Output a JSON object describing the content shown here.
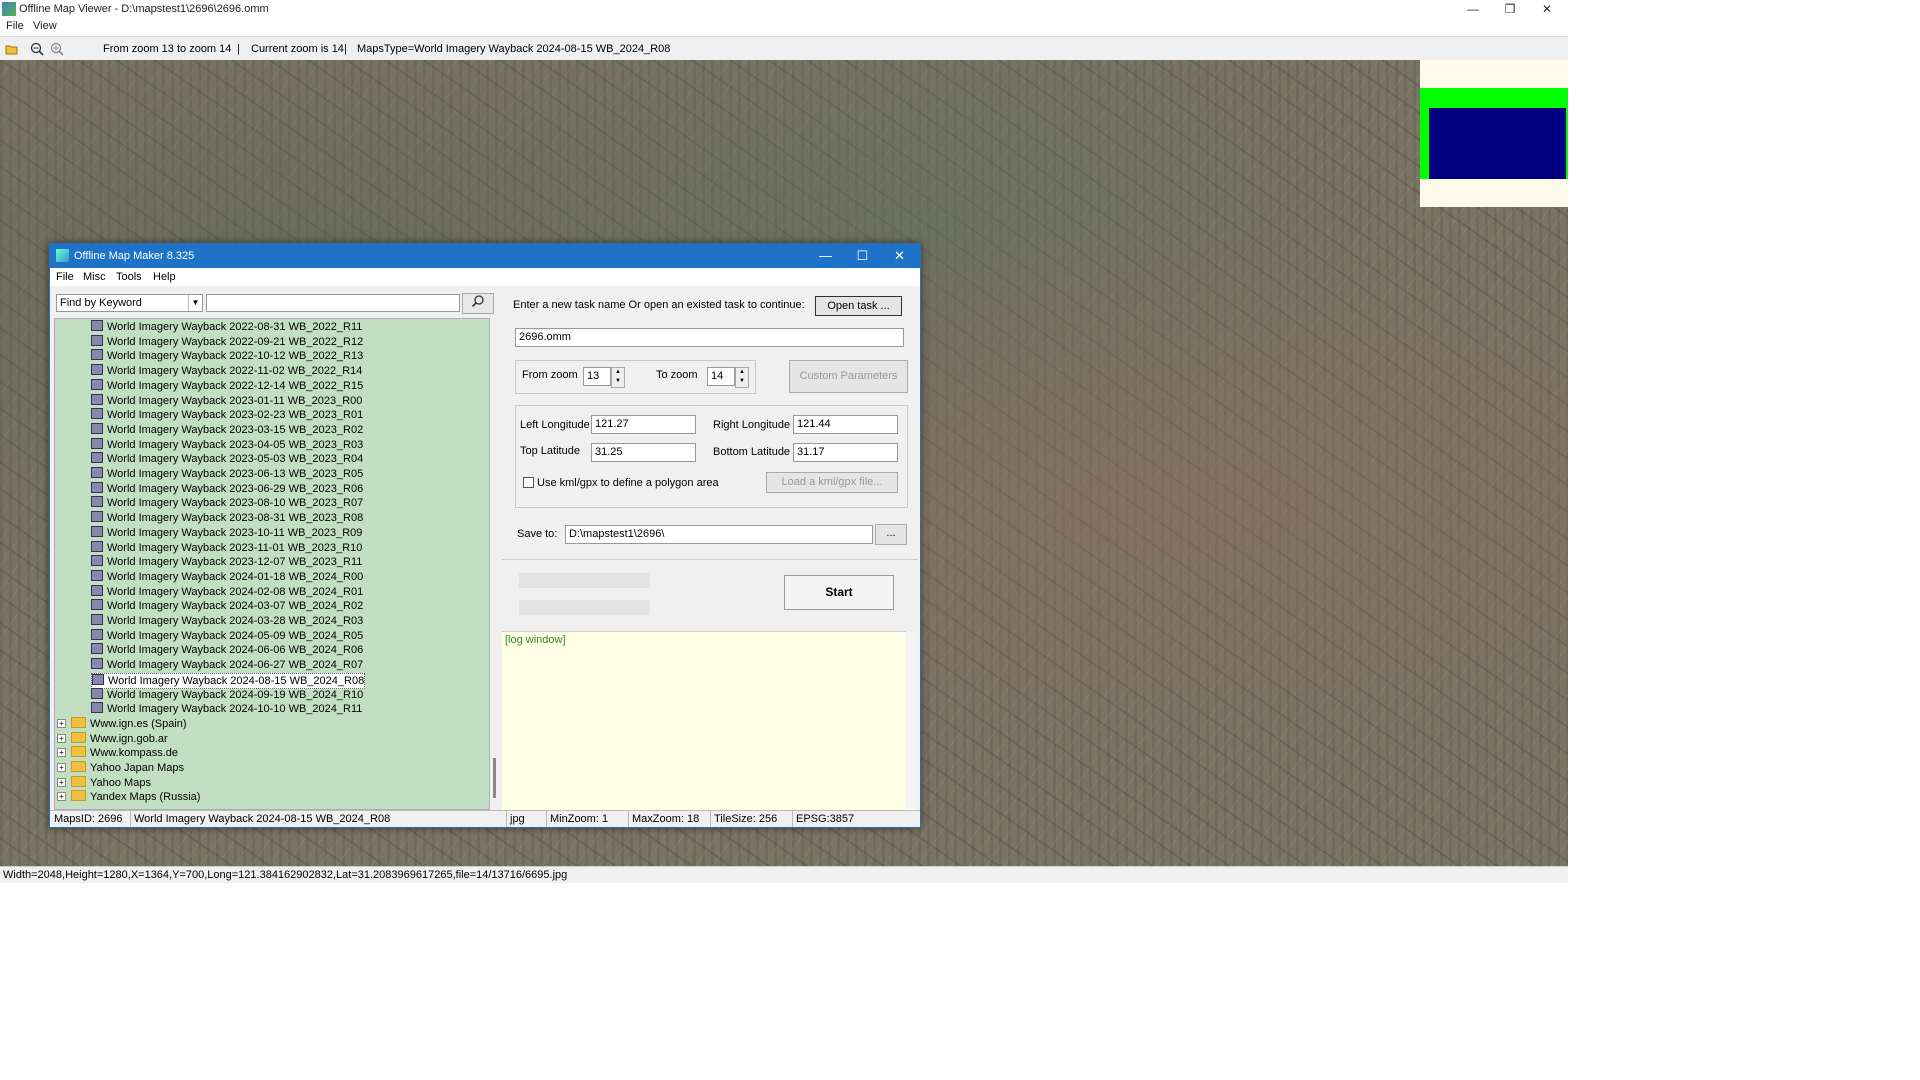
{
  "window": {
    "title": "Offline Map Viewer - D:\\mapstest1\\2696\\2696.omm",
    "menu": [
      "File",
      "View"
    ],
    "controls": {
      "minimize": "—",
      "maximize": "❐",
      "close": "✕"
    }
  },
  "toolbar": {
    "zoom_range": "From zoom 13 to zoom 14",
    "sep1": "|",
    "current_zoom": "Current zoom is 14",
    "sep2": "|",
    "maps_type": "MapsType=World Imagery Wayback 2024-08-15 WB_2024_R08",
    "icons": [
      "folder-open-icon",
      "zoom-out-icon",
      "zoom-in-icon"
    ]
  },
  "statusbar": {
    "text": "Width=2048,Height=1280,X=1364,Y=700,Long=121.384162902832,Lat=31.2083969617265,file=14/13716/6695.jpg"
  },
  "minimap": {
    "colors": {
      "background": "#fffbea",
      "frame": "#00ff00",
      "view": "#000080"
    }
  },
  "dialog": {
    "title": "Offline Map Maker 8.325",
    "menu": [
      "File",
      "Misc",
      "Tools",
      "Help"
    ],
    "controls": {
      "minimize": "—",
      "maximize": "☐",
      "close": "✕"
    },
    "search": {
      "mode": "Find by Keyword",
      "query": "",
      "button_icon": "search-icon"
    },
    "tree": {
      "leaves": [
        "World Imagery Wayback 2022-08-31 WB_2022_R11",
        "World Imagery Wayback 2022-09-21 WB_2022_R12",
        "World Imagery Wayback 2022-10-12 WB_2022_R13",
        "World Imagery Wayback 2022-11-02 WB_2022_R14",
        "World Imagery Wayback 2022-12-14 WB_2022_R15",
        "World Imagery Wayback 2023-01-11 WB_2023_R00",
        "World Imagery Wayback 2023-02-23 WB_2023_R01",
        "World Imagery Wayback 2023-03-15 WB_2023_R02",
        "World Imagery Wayback 2023-04-05 WB_2023_R03",
        "World Imagery Wayback 2023-05-03 WB_2023_R04",
        "World Imagery Wayback 2023-06-13 WB_2023_R05",
        "World Imagery Wayback 2023-06-29 WB_2023_R06",
        "World Imagery Wayback 2023-08-10 WB_2023_R07",
        "World Imagery Wayback 2023-08-31 WB_2023_R08",
        "World Imagery Wayback 2023-10-11 WB_2023_R09",
        "World Imagery Wayback 2023-11-01 WB_2023_R10",
        "World Imagery Wayback 2023-12-07 WB_2023_R11",
        "World Imagery Wayback 2024-01-18 WB_2024_R00",
        "World Imagery Wayback 2024-02-08 WB_2024_R01",
        "World Imagery Wayback 2024-03-07 WB_2024_R02",
        "World Imagery Wayback 2024-03-28 WB_2024_R03",
        "World Imagery Wayback 2024-05-09 WB_2024_R05",
        "World Imagery Wayback 2024-06-06 WB_2024_R06",
        "World Imagery Wayback 2024-06-27 WB_2024_R07",
        "World Imagery Wayback 2024-08-15 WB_2024_R08",
        "World Imagery Wayback 2024-09-19 WB_2024_R10",
        "World Imagery Wayback 2024-10-10 WB_2024_R11"
      ],
      "selected": "World Imagery Wayback 2024-08-15 WB_2024_R08",
      "folders": [
        "Www.ign.es (Spain)",
        "Www.ign.gob.ar",
        "Www.kompass.de",
        "Yahoo Japan Maps",
        "Yahoo Maps",
        "Yandex Maps (Russia)"
      ],
      "expander": "+"
    },
    "task": {
      "prompt": "Enter a new task name Or open an existed task to continue:",
      "open_button": "Open task ...",
      "name": "2696.omm"
    },
    "zoom": {
      "from_label": "From zoom",
      "from_value": "13",
      "to_label": "To zoom",
      "to_value": "14",
      "custom_button": "Custom Parameters"
    },
    "bounds": {
      "left_label": "Left Longitude",
      "left_value": "121.27",
      "right_label": "Right Longitude",
      "right_value": "121.44",
      "top_label": "Top Latitude",
      "top_value": "31.25",
      "bottom_label": "Bottom Latitude",
      "bottom_value": "31.17",
      "kml_checkbox_label": "Use kml/gpx to define a polygon area",
      "kml_checked": false,
      "kml_button": "Load a kml/gpx file..."
    },
    "save": {
      "label": "Save to:",
      "path": "D:\\mapstest1\\2696\\",
      "browse_button": "..."
    },
    "start_button": "Start",
    "log_text": "[log window]",
    "status": {
      "maps_id": "MapsID: 2696",
      "maps_name": "World Imagery Wayback 2024-08-15 WB_2024_R08",
      "format": "jpg",
      "min_zoom": "MinZoom: 1",
      "max_zoom": "MaxZoom: 18",
      "tile_size": "TileSize: 256",
      "epsg": "EPSG:3857"
    }
  }
}
